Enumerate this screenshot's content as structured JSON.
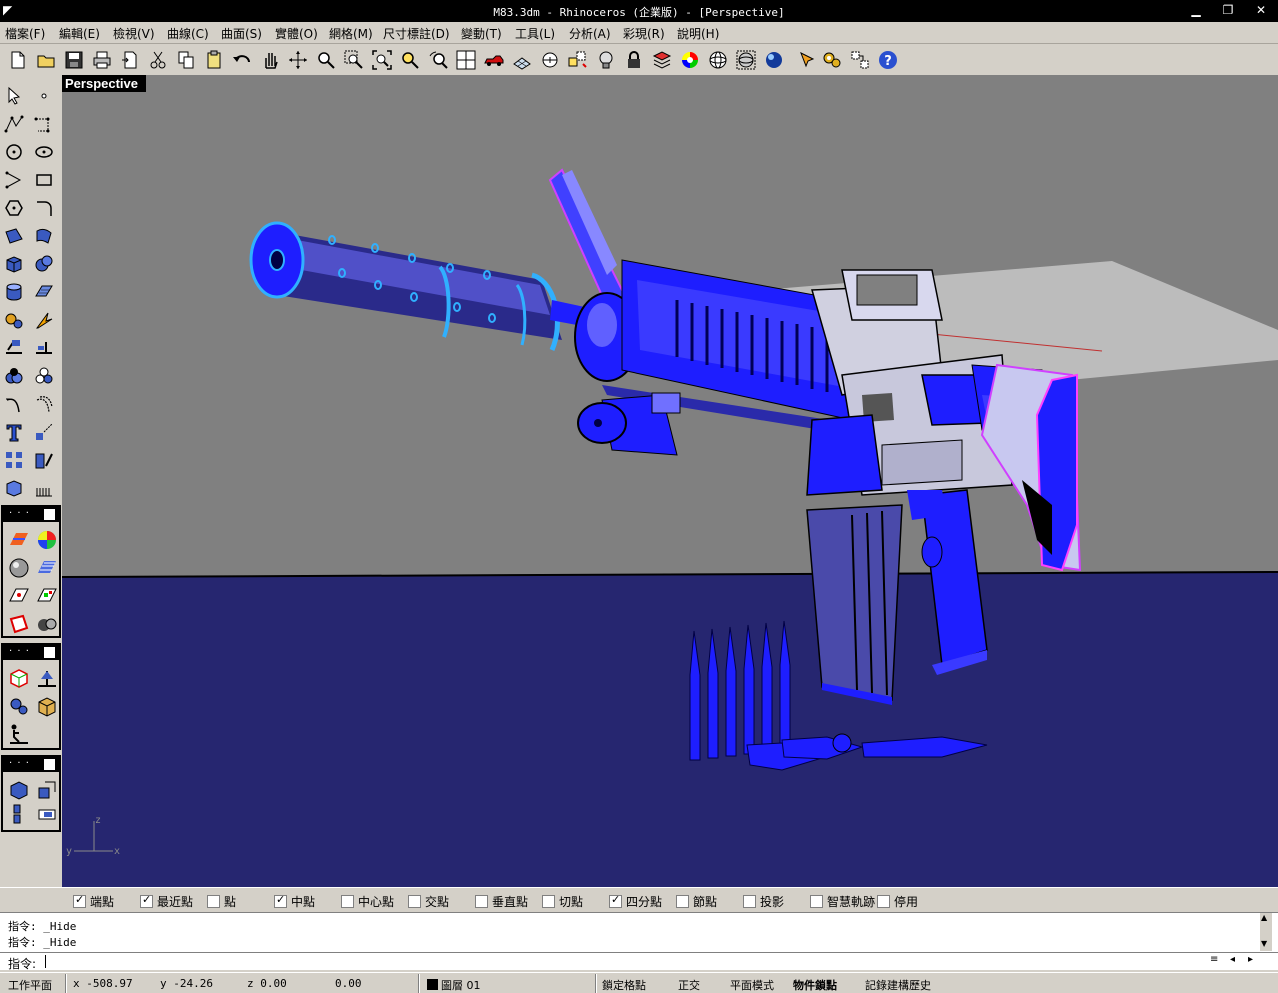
{
  "window": {
    "title": "M83.3dm - Rhinoceros (企業版) - [Perspective]",
    "minimize_glyph": "▁",
    "restore_glyph": "❐",
    "close_glyph": "✕"
  },
  "menu": {
    "items": [
      "檔案(F)",
      "編輯(E)",
      "檢視(V)",
      "曲線(C)",
      "曲面(S)",
      "實體(O)",
      "網格(M)",
      "尺寸標註(D)",
      "變動(T)",
      "工具(L)",
      "分析(A)",
      "彩現(R)",
      "說明(H)"
    ]
  },
  "toolbar": {
    "icons": [
      "new-file-icon",
      "open-folder-icon",
      "save-icon",
      "print-icon",
      "import-icon",
      "cut-icon",
      "copy-icon",
      "paste-icon",
      "undo-icon",
      "pan-hand-icon",
      "rotate-view-icon",
      "zoom-icon",
      "zoom-window-icon",
      "zoom-extents-icon",
      "zoom-selected-icon",
      "undo-view-icon",
      "four-viewports-icon",
      "car-icon",
      "grid-plane-icon",
      "cplane-icon",
      "named-view-icon",
      "light-bulb-icon",
      "lock-icon",
      "layer-icon",
      "color-wheel-icon",
      "sphere-wireframe-icon",
      "sphere-grid-icon",
      "render-sphere-icon",
      "pen-icon",
      "gears-icon",
      "options-icon",
      "help-icon"
    ]
  },
  "viewport": {
    "label": "Perspective",
    "background_color": "#808080",
    "floor_color": "#262670",
    "model_color": "#1e1eff"
  },
  "axes": {
    "z": "z",
    "y": "y",
    "x": "x"
  },
  "osnap": {
    "items": [
      {
        "label": "端點",
        "checked": true
      },
      {
        "label": "最近點",
        "checked": true
      },
      {
        "label": "點",
        "checked": false
      },
      {
        "label": "中點",
        "checked": true
      },
      {
        "label": "中心點",
        "checked": false
      },
      {
        "label": "交點",
        "checked": false
      },
      {
        "label": "垂直點",
        "checked": false
      },
      {
        "label": "切點",
        "checked": false
      },
      {
        "label": "四分點",
        "checked": true
      },
      {
        "label": "節點",
        "checked": false
      },
      {
        "label": "投影",
        "checked": false
      },
      {
        "label": "智慧軌跡",
        "checked": false
      },
      {
        "label": "停用",
        "checked": false
      }
    ]
  },
  "command": {
    "history": [
      "指令: _Hide",
      "指令: _Hide"
    ],
    "prompt": "指令:",
    "scroll_up": "▲",
    "scroll_down": "▼"
  },
  "status": {
    "cplane": "工作平面",
    "x": "x -508.97",
    "y": "y -24.26",
    "z": "z 0.00",
    "other": "0.00",
    "layer": "圖層 01",
    "grid_snap": "鎖定格點",
    "ortho": "正交",
    "planar": "平面模式",
    "osnap": "物件鎖點",
    "history": "記錄建構歷史"
  }
}
